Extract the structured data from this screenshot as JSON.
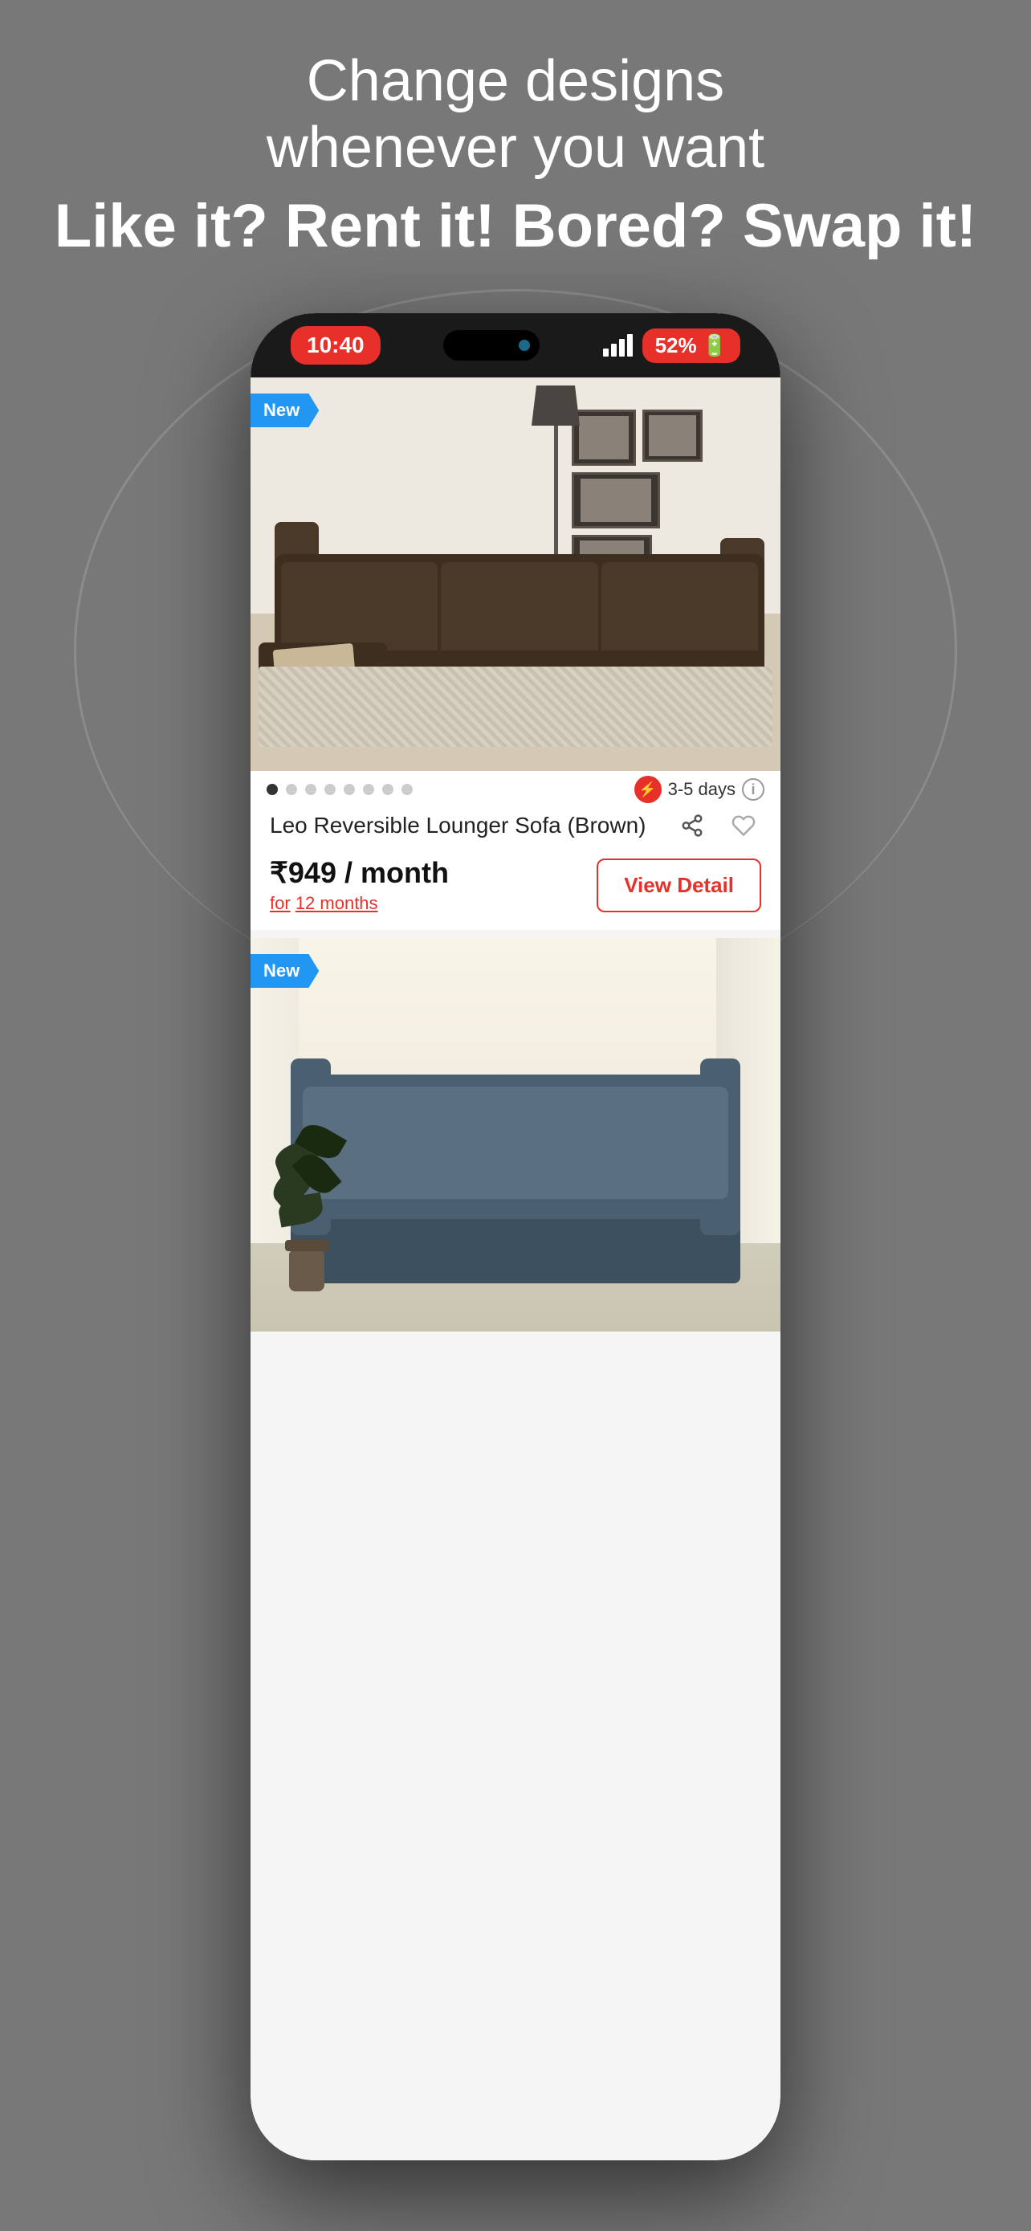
{
  "header": {
    "line1": "Change designs",
    "line2": "whenever you want",
    "line3": "Like it? Rent it! Bored? Swap it!"
  },
  "status_bar": {
    "time": "10:40",
    "battery": "52%",
    "battery_icon": "🔋"
  },
  "product1": {
    "badge": "New",
    "title": "Leo Reversible Lounger Sofa (Brown)",
    "price": "₹949 / month",
    "duration_label": "for",
    "duration": "12 months",
    "delivery": "3-5 days",
    "view_detail_label": "View Detail",
    "dots_count": 8,
    "active_dot": 0
  },
  "product2": {
    "badge": "New"
  }
}
